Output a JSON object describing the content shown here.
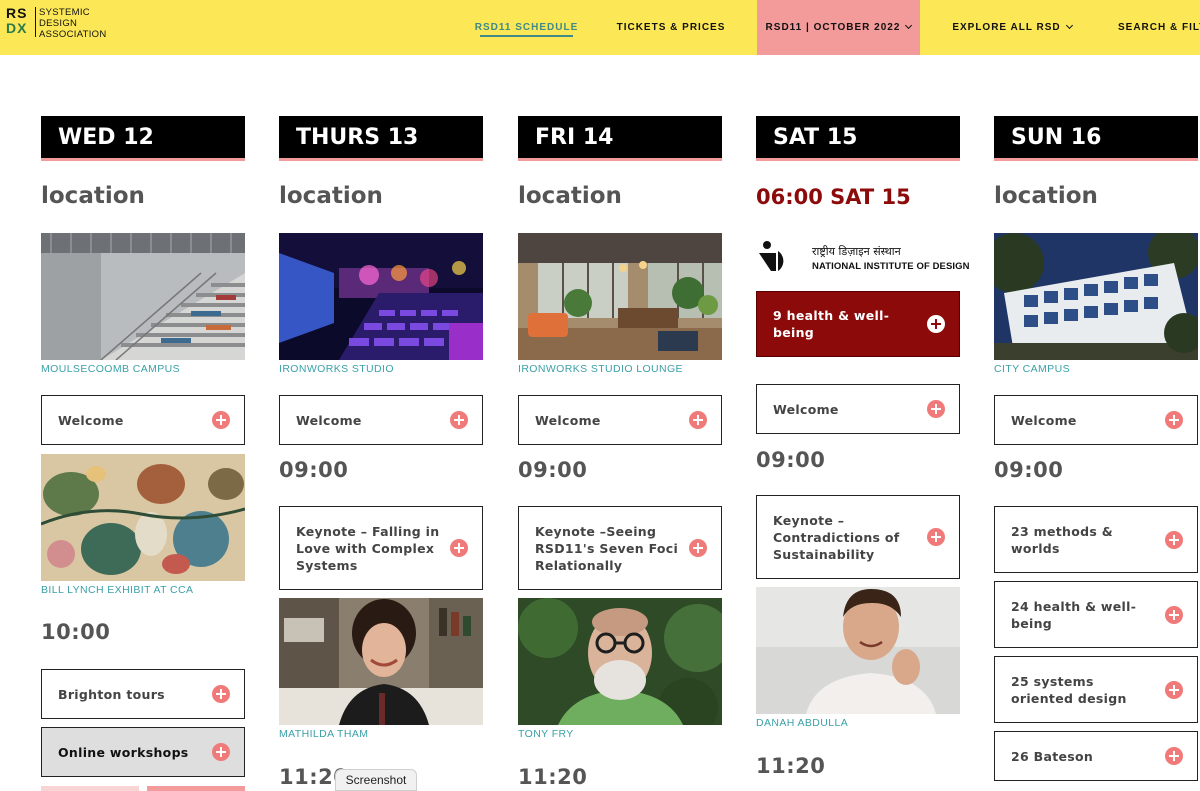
{
  "header": {
    "logo_mark_line1": "RS",
    "logo_mark_line2": "DX",
    "logo_text": [
      "SYSTEMIC",
      "DESIGN",
      "ASSOCIATION"
    ],
    "nav": [
      {
        "label": "RSD11 SCHEDULE",
        "active": true
      },
      {
        "label": "TICKETS & PRICES"
      },
      {
        "label": "RSD11 | OCTOBER 2022",
        "highlight": true,
        "dropdown": true
      },
      {
        "label": "EXPLORE ALL RSD",
        "dropdown": true
      },
      {
        "label": "SEARCH & FILT"
      }
    ],
    "colors": {
      "bar": "#fce856",
      "active": "#3f8a86",
      "highlight": "#f39a9a"
    }
  },
  "days": [
    {
      "heading": "WED 12",
      "location_title": "location",
      "photo_caption": "MOULSECOOMB CAMPUS",
      "welcome_label": "Welcome",
      "photo2_caption": "BILL LYNCH EXHIBIT AT CCA",
      "time1": "10:00",
      "session1": "Brighton tours",
      "session2": "Online workshops"
    },
    {
      "heading": "THURS 13",
      "location_title": "location",
      "photo_caption": "IRONWORKS STUDIO",
      "welcome_label": "Welcome",
      "time1": "09:00",
      "session1": "Keynote – Falling in Love with Complex Systems",
      "speaker": "MATHILDA THAM",
      "time2": "11:20"
    },
    {
      "heading": "FRI 14",
      "location_title": "location",
      "photo_caption": "IRONWORKS STUDIO LOUNGE",
      "welcome_label": "Welcome",
      "time1": "09:00",
      "session1": "Keynote –Seeing RSD11's Seven Foci Relationally",
      "speaker": "TONY FRY",
      "time2": "11:20"
    },
    {
      "heading": "SAT 15",
      "location_title": "06:00 SAT 15",
      "org_hindi": "राष्ट्रीय डिज़ाइन संस्थान",
      "org_english": "NATIONAL INSTITUTE OF DESIGN",
      "featured_session": "9 health & well-being",
      "welcome_label": "Welcome",
      "time1": "09:00",
      "session1": "Keynote – Contradictions of Sustainability",
      "speaker": "DANAH ABDULLA",
      "time2": "11:20"
    },
    {
      "heading": "SUN 16",
      "location_title": "location",
      "photo_caption": "CITY CAMPUS",
      "welcome_label": "Welcome",
      "time1": "09:00",
      "sessions": [
        "23 methods & worlds",
        "24 health & well-being",
        "25 systems oriented design",
        "26 Bateson"
      ]
    }
  ],
  "tooltip": "Screenshot"
}
